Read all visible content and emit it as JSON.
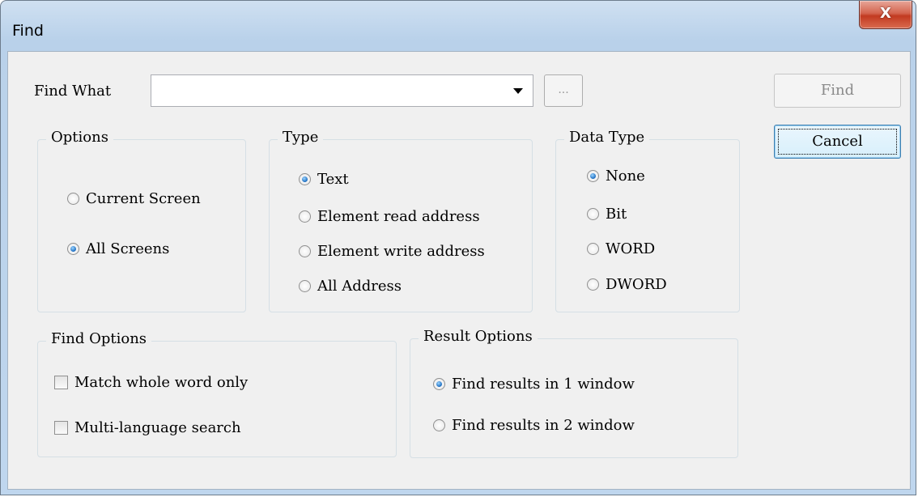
{
  "window": {
    "title": "Find",
    "close_glyph": "X"
  },
  "find_what": {
    "label": "Find What",
    "value": "",
    "browse_label": "..."
  },
  "buttons": {
    "find": "Find",
    "cancel": "Cancel"
  },
  "options": {
    "title": "Options",
    "items": [
      {
        "label": "Current Screen",
        "checked": false
      },
      {
        "label": "All Screens",
        "checked": true
      }
    ]
  },
  "type": {
    "title": "Type",
    "items": [
      {
        "label": "Text",
        "checked": true
      },
      {
        "label": "Element read address",
        "checked": false
      },
      {
        "label": "Element write address",
        "checked": false
      },
      {
        "label": "All Address",
        "checked": false
      }
    ]
  },
  "data_type": {
    "title": "Data Type",
    "items": [
      {
        "label": "None",
        "checked": true
      },
      {
        "label": "Bit",
        "checked": false
      },
      {
        "label": "WORD",
        "checked": false
      },
      {
        "label": "DWORD",
        "checked": false
      }
    ]
  },
  "find_options": {
    "title": "Find Options",
    "items": [
      {
        "label": "Match whole word only",
        "checked": false
      },
      {
        "label": "Multi-language search",
        "checked": false
      }
    ]
  },
  "result_options": {
    "title": "Result Options",
    "items": [
      {
        "label": "Find results in 1 window",
        "checked": true
      },
      {
        "label": "Find results in 2 window",
        "checked": false
      }
    ]
  }
}
